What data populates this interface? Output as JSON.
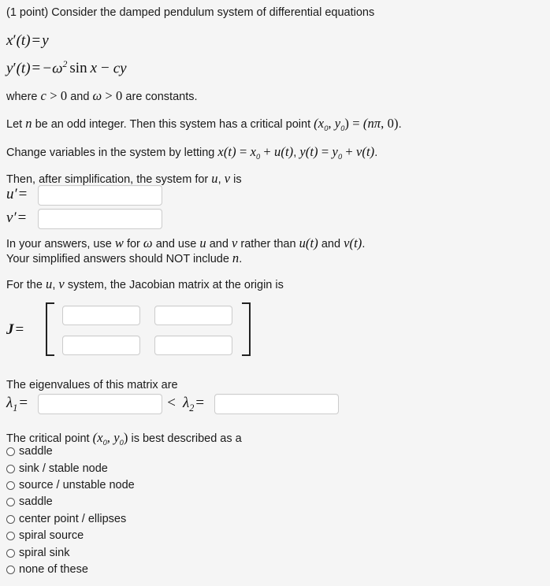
{
  "problem": {
    "points_prefix": "(1 point) Consider the damped pendulum system of differential equations",
    "eq1": {
      "lhs_var": "x",
      "prime": "′",
      "arg": "(t)",
      "equals": "=",
      "rhs": "y"
    },
    "eq2": {
      "lhs_var": "y",
      "prime": "′",
      "arg": "(t)",
      "equals": "=",
      "minus": "−",
      "omega": "ω",
      "exponent": "2",
      "sin": "sin",
      "x": "x",
      "minus2": "−",
      "c": "c",
      "y": "y"
    },
    "constants_line": {
      "where": "where ",
      "c": "c",
      "gt1": " > ",
      "zero1": "0",
      "and": " and ",
      "omega": "ω",
      "gt2": " > ",
      "zero2": "0",
      "tail": " are constants."
    },
    "odd_integer_line": {
      "a": "Let ",
      "n": "n",
      "b": " be an odd integer. Then this system has a critical point ",
      "point_lhs": "(x",
      "sub0a": "0",
      "comma": ", y",
      "sub0b": "0",
      "close": ")",
      "equals": " = ",
      "point_rhs_open": "(n",
      "pi": "π",
      "point_rhs_close": ", 0)",
      "period": "."
    },
    "change_variables_line": {
      "a": "Change variables in the system by letting ",
      "x_of_t": "x(t)",
      "eq1": " = ",
      "x0": "x",
      "x0sub": "0",
      "plus1": " + ",
      "u_of_t": "u(t)",
      "comma": ", ",
      "y_of_t": "y(t)",
      "eq2": " = ",
      "y0": "y",
      "y0sub": "0",
      "plus2": " + ",
      "v_of_t": "v(t)",
      "period": "."
    },
    "after_simplification_line": {
      "a": "Then, after simplification, the system for ",
      "u": "u",
      "comma": ", ",
      "v": "v",
      "b": " is"
    }
  },
  "system_inputs": {
    "u_label": {
      "var": "u",
      "prime": "′",
      "equals": "="
    },
    "v_label": {
      "var": "v",
      "prime": "′",
      "equals": "="
    },
    "u_value": "",
    "v_value": "",
    "placeholder": ""
  },
  "instructions": {
    "line1": {
      "a": "In your answers, use ",
      "w": "w",
      "b": " for ",
      "omega": "ω",
      "c": " and use ",
      "u": "u",
      "d": " and ",
      "v": "v",
      "e": " rather than ",
      "u_of_t": "u(t)",
      "f": " and ",
      "v_of_t": "v(t)",
      "period": "."
    },
    "line2": {
      "a": "Your simplified answers should NOT include ",
      "n": "n",
      "period": "."
    }
  },
  "jacobian": {
    "heading": {
      "a": "For the ",
      "u": "u",
      "comma": ", ",
      "v": "v",
      "b": " system, the Jacobian matrix at the origin is"
    },
    "label": {
      "J": "J",
      "equals": "="
    },
    "cells": [
      {
        "name": "j11",
        "value": ""
      },
      {
        "name": "j12",
        "value": ""
      },
      {
        "name": "j21",
        "value": ""
      },
      {
        "name": "j22",
        "value": ""
      }
    ],
    "bracket_left": "[",
    "bracket_right": "]"
  },
  "eigenvalues": {
    "heading": "The eigenvalues of this matrix are",
    "lambda1": {
      "symbol": "λ",
      "sub": "1",
      "equals": "="
    },
    "comparator": "<",
    "lambda2": {
      "symbol": "λ",
      "sub": "2",
      "equals": "="
    },
    "lambda1_value": "",
    "lambda2_value": ""
  },
  "classification": {
    "prompt": {
      "a": "The critical point ",
      "open": "(x",
      "sub0a": "0",
      "comma": ", y",
      "sub0b": "0",
      "close": ")",
      "b": " is best described as a"
    },
    "options": [
      {
        "label": "saddle",
        "selected": false
      },
      {
        "label": "sink / stable node",
        "selected": false
      },
      {
        "label": "source / unstable node",
        "selected": false
      },
      {
        "label": "saddle",
        "selected": false
      },
      {
        "label": "center point / ellipses",
        "selected": false
      },
      {
        "label": "spiral source",
        "selected": false
      },
      {
        "label": "spiral sink",
        "selected": false
      },
      {
        "label": "none of these",
        "selected": false
      }
    ]
  },
  "colors": {
    "background": "#f5f5f5",
    "text": "#1a1a1a",
    "input_border": "#cccccc",
    "input_background": "#ffffff",
    "bracket": "#222222"
  }
}
